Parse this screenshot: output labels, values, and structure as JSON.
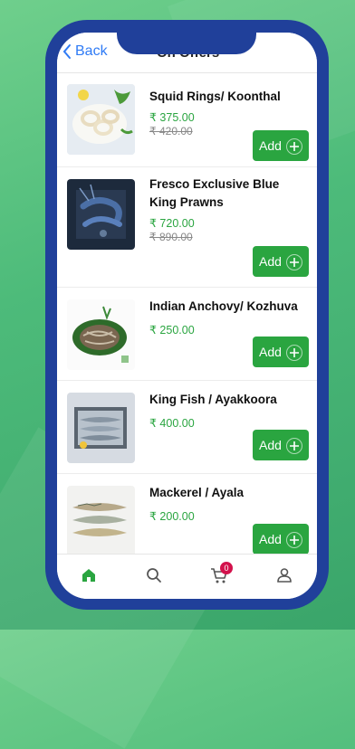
{
  "header": {
    "back_label": "Back",
    "title": "On Offers"
  },
  "products": [
    {
      "name": "Squid Rings/ Koonthal",
      "price": "₹ 375.00",
      "mrp": "₹ 420.00",
      "add_label": "Add"
    },
    {
      "name": "Fresco Exclusive Blue King Prawns",
      "price": "₹ 720.00",
      "mrp": "₹ 890.00",
      "add_label": "Add"
    },
    {
      "name": "Indian Anchovy/ Kozhuva",
      "price": "₹ 250.00",
      "add_label": "Add"
    },
    {
      "name": "King Fish / Ayakkoora",
      "price": "₹ 400.00",
      "add_label": "Add"
    },
    {
      "name": "Mackerel / Ayala",
      "price": "₹ 200.00",
      "add_label": "Add"
    }
  ],
  "tabbar": {
    "cart_count": "0"
  },
  "colors": {
    "accent_green": "#2aa540",
    "brand_blue": "#20409a",
    "link_blue": "#2f7bf5",
    "badge": "#d3124c"
  }
}
